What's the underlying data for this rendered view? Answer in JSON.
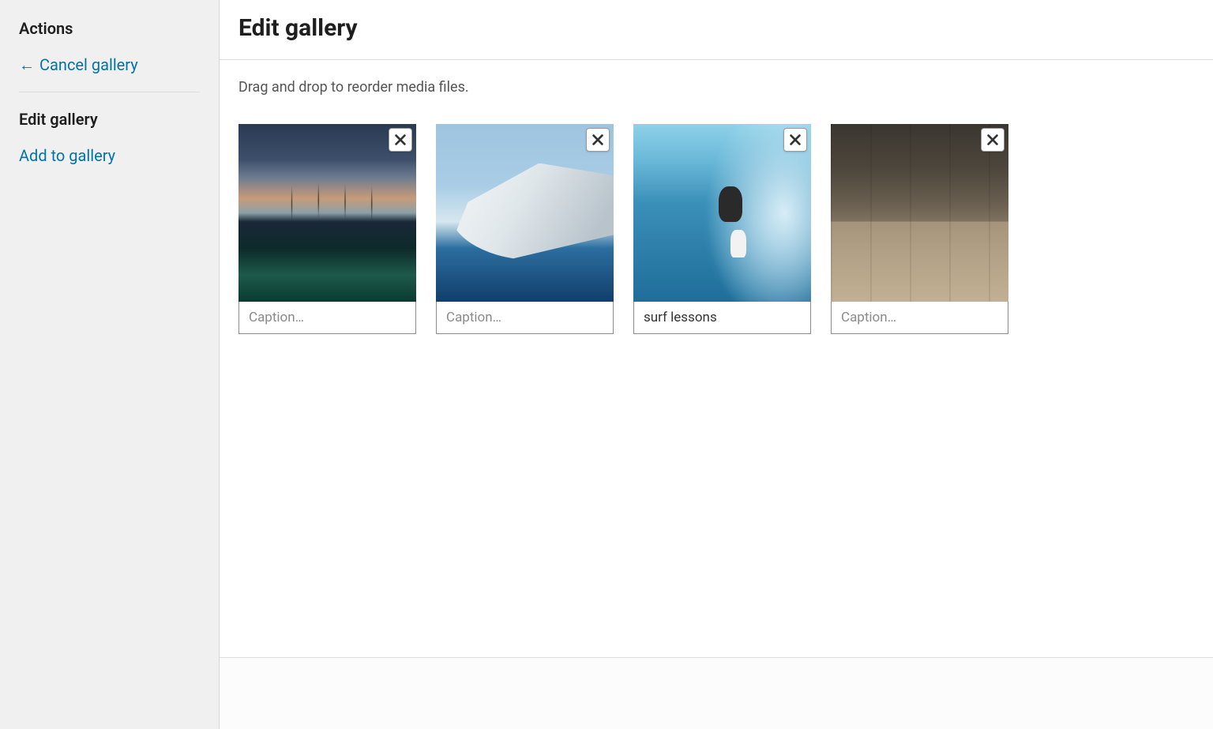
{
  "sidebar": {
    "actions_heading": "Actions",
    "cancel_label": "Cancel gallery",
    "edit_heading": "Edit gallery",
    "add_label": "Add to gallery"
  },
  "main": {
    "title": "Edit gallery",
    "instruction": "Drag and drop to reorder media files."
  },
  "gallery": {
    "caption_placeholder": "Caption…",
    "items": [
      {
        "caption": "",
        "alt": "resort-pool-sunset"
      },
      {
        "caption": "",
        "alt": "yacht-ocean"
      },
      {
        "caption": "surf lessons",
        "alt": "surfer-wave"
      },
      {
        "caption": "",
        "alt": "cafe-interior"
      }
    ]
  }
}
